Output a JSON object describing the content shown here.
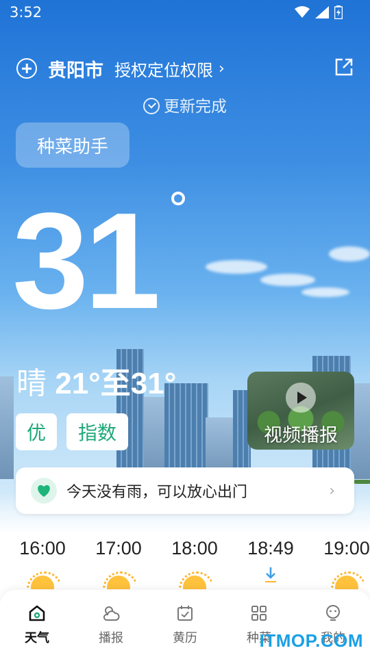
{
  "status_bar": {
    "time": "3:52"
  },
  "location_bar": {
    "city": "贵阳市",
    "auth_text": "授权定位权限",
    "chevron": "›"
  },
  "update_status": "更新完成",
  "helper_button": "种菜助手",
  "current": {
    "temperature": "31",
    "condition": "晴",
    "range": "21°至31°"
  },
  "aqi_badges": {
    "quality": "优",
    "index": "指数"
  },
  "video": {
    "label": "视频播报"
  },
  "rain_notice": {
    "text": "今天没有雨，可以放心出门",
    "chevron": "›"
  },
  "hourly": [
    {
      "time": "16:00",
      "icon": "sun-icon"
    },
    {
      "time": "17:00",
      "icon": "sun-icon"
    },
    {
      "time": "18:00",
      "icon": "sun-icon"
    },
    {
      "time": "18:49",
      "icon": "sunset-icon"
    },
    {
      "time": "19:00",
      "icon": "sun-icon"
    }
  ],
  "tabs": [
    {
      "label": "天气",
      "icon": "home-icon",
      "active": true
    },
    {
      "label": "播报",
      "icon": "cloud-sun-icon",
      "active": false
    },
    {
      "label": "黄历",
      "icon": "calendar-icon",
      "active": false
    },
    {
      "label": "种菜",
      "icon": "grid-icon",
      "active": false
    },
    {
      "label": "我的",
      "icon": "profile-icon",
      "active": false
    }
  ],
  "watermark": "ITMOP.COM",
  "colors": {
    "accent_green": "#1fa87a",
    "sky_top": "#1f73d6",
    "watermark": "#1aa0e6"
  }
}
